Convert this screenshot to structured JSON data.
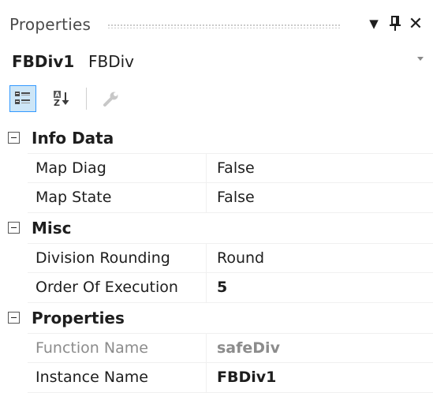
{
  "window": {
    "title": "Properties",
    "dropdown_icon": "▼",
    "pin_icon": "pin-icon",
    "close_icon": "✕"
  },
  "object_selector": {
    "name": "FBDiv1",
    "type": "FBDiv"
  },
  "toolbar": {
    "categorized": "categorized-icon",
    "alphabetical": "sort-alphabetical-icon",
    "property_pages": "wrench-icon"
  },
  "categories": [
    {
      "label": "Info Data",
      "rows": [
        {
          "name": "Map Diag",
          "value": "False"
        },
        {
          "name": "Map State",
          "value": "False"
        }
      ]
    },
    {
      "label": "Misc",
      "rows": [
        {
          "name": "Division Rounding",
          "value": "Round"
        },
        {
          "name": "Order Of Execution",
          "value": "5"
        }
      ]
    },
    {
      "label": "Properties",
      "rows": [
        {
          "name": "Function Name",
          "value": "safeDiv"
        },
        {
          "name": "Instance Name",
          "value": "FBDiv1"
        }
      ]
    }
  ],
  "colors": {
    "accent_border": "#3399ff",
    "accent_fill": "#cde6f7",
    "readonly_text": "#8c8c8c"
  }
}
